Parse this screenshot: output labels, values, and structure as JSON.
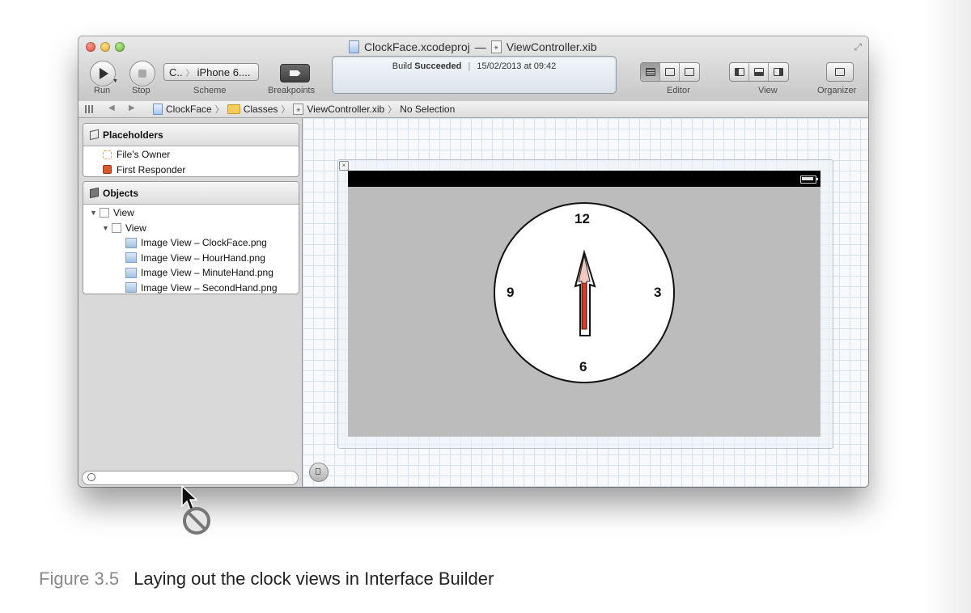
{
  "window": {
    "title_project": "ClockFace.xcodeproj",
    "title_separator": "—",
    "title_file": "ViewController.xib"
  },
  "toolbar": {
    "run_label": "Run",
    "stop_label": "Stop",
    "scheme_target": "C..",
    "scheme_device": "iPhone 6....",
    "scheme_label": "Scheme",
    "breakpoints_label": "Breakpoints",
    "activity_prefix": "Build",
    "activity_status": "Succeeded",
    "activity_divider": "|",
    "activity_time": "15/02/2013 at 09:42",
    "editor_label": "Editor",
    "view_label": "View",
    "organizer_label": "Organizer"
  },
  "jumpbar": {
    "crumbs": [
      "ClockFace",
      "Classes",
      "ViewController.xib",
      "No Selection"
    ]
  },
  "navigator": {
    "placeholders_title": "Placeholders",
    "placeholders": [
      "File's Owner",
      "First Responder"
    ],
    "objects_title": "Objects",
    "objects": [
      {
        "label": "View"
      },
      {
        "label": "View"
      },
      {
        "label": "Image View – ClockFace.png"
      },
      {
        "label": "Image View – HourHand.png"
      },
      {
        "label": "Image View – MinuteHand.png"
      },
      {
        "label": "Image View – SecondHand.png"
      }
    ]
  },
  "clock": {
    "numbers": [
      "12",
      "3",
      "6",
      "9"
    ],
    "hand_time": "12:00",
    "colors": {
      "outline": "#111111",
      "second_hand": "#d9392b",
      "minute_hand": "#f4c8c0",
      "face": "#ffffff",
      "background": "#bcbcbc"
    }
  },
  "caption": {
    "figure": "Figure 3.5",
    "text": "Laying out the clock views in Interface Builder"
  },
  "icons": [
    "close-icon",
    "minimize-icon",
    "zoom-icon",
    "fullscreen-icon",
    "play-icon",
    "stop-icon",
    "breakpoints-icon",
    "xcodeproj-icon",
    "xib-icon",
    "folder-icon",
    "cube-icon",
    "battery-icon",
    "not-allowed-cursor-icon"
  ]
}
